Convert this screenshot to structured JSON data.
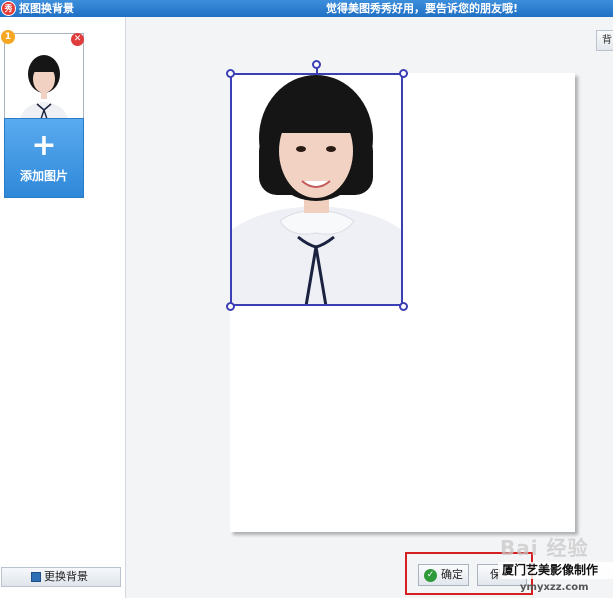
{
  "window": {
    "logo_text": "秀",
    "title": "抠图换背景",
    "slogan": "觉得美图秀秀好用，要告诉您的朋友哦!"
  },
  "sidebar": {
    "thumbnail": {
      "badge": "1",
      "remove_icon": "close-icon"
    },
    "add_image_label": "添加图片",
    "add_image_icon": "plus-icon",
    "change_background_label": "更换背景",
    "change_background_icon": "image-icon"
  },
  "workspace": {
    "top_right_button_label": "背",
    "canvas_color": "#ffffff",
    "selection_color": "#3b3fb5"
  },
  "actions": {
    "confirm_label": "确定",
    "confirm_icon": "check-icon",
    "save_label": "保",
    "highlight_color": "#d42020"
  },
  "watermark": {
    "baidu": "Bai 经验",
    "line1": "厦门艺美影像制作",
    "line2": "ymyxzz.com"
  }
}
